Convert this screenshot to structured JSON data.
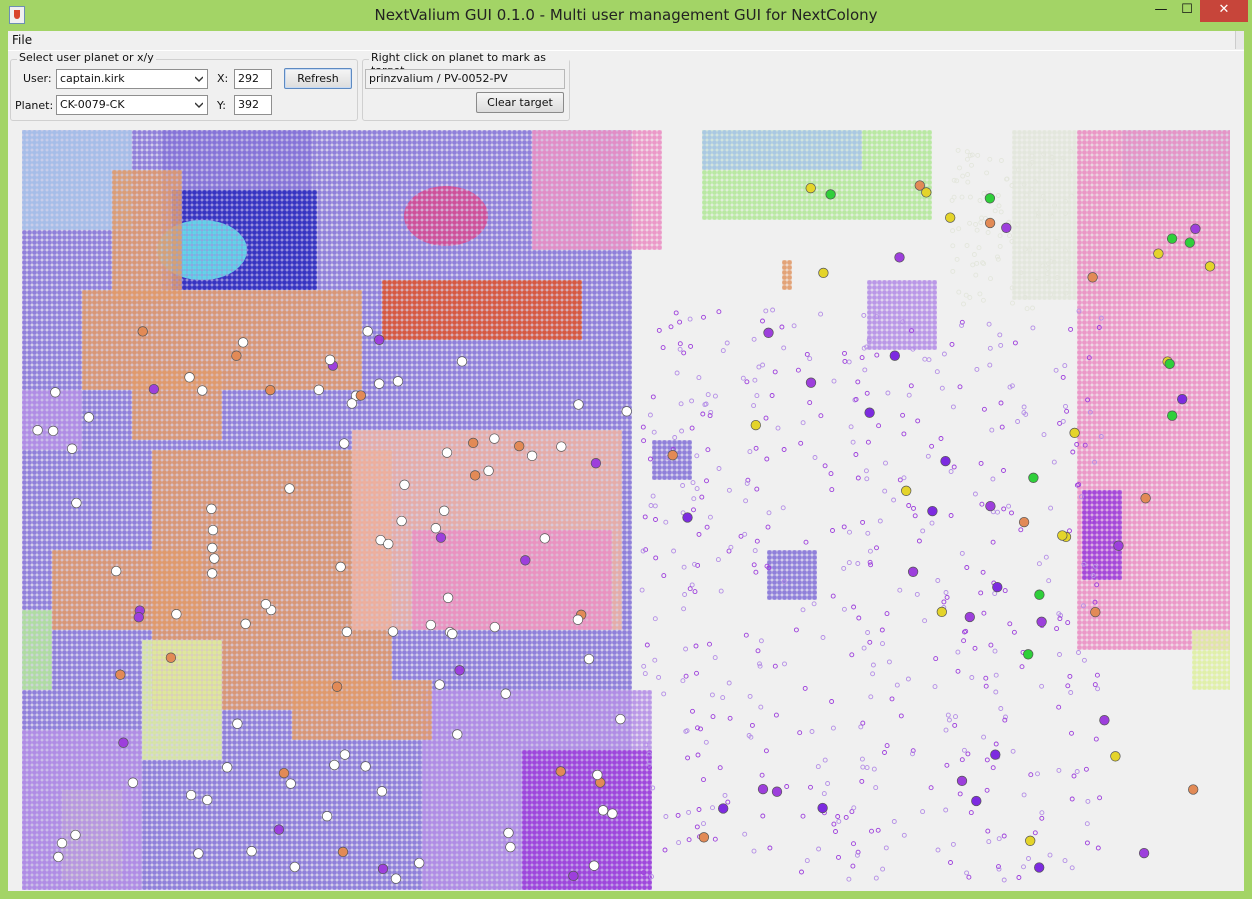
{
  "window": {
    "title": "NextValium GUI 0.1.0 - Multi user management GUI for NextColony",
    "minimize_glyph": "—",
    "maximize_glyph": "☐",
    "close_glyph": "✕"
  },
  "menu": {
    "file_label": "File"
  },
  "select_panel": {
    "legend": "Select user planet or x/y",
    "user_label": "User:",
    "user_value": "captain.kirk",
    "planet_label": "Planet:",
    "planet_value": "CK-0079-CK",
    "x_label": "X:",
    "x_value": "292",
    "y_label": "Y:",
    "y_value": "392",
    "refresh_label": "Refresh"
  },
  "target_panel": {
    "legend": "Right click on planet to mark as target",
    "target_value": "prinzvalium / PV-0052-PV",
    "clear_label": "Clear target"
  },
  "map": {
    "description_colors": {
      "sky": "#a9c6ea",
      "violet": "#8573d8",
      "orange": "#e29a6a",
      "navy": "#2d2dc0",
      "cyan": "#6ae4ec",
      "magenta": "#d64a92",
      "red": "#e0552e",
      "pink": "#eb8fc4",
      "lilac": "#b48ee6",
      "salmon": "#f0b2a2",
      "lime": "#dff0a2",
      "green": "#b3e89a",
      "grey": "#e3e6dc",
      "purple": "#9d3fdc"
    }
  }
}
